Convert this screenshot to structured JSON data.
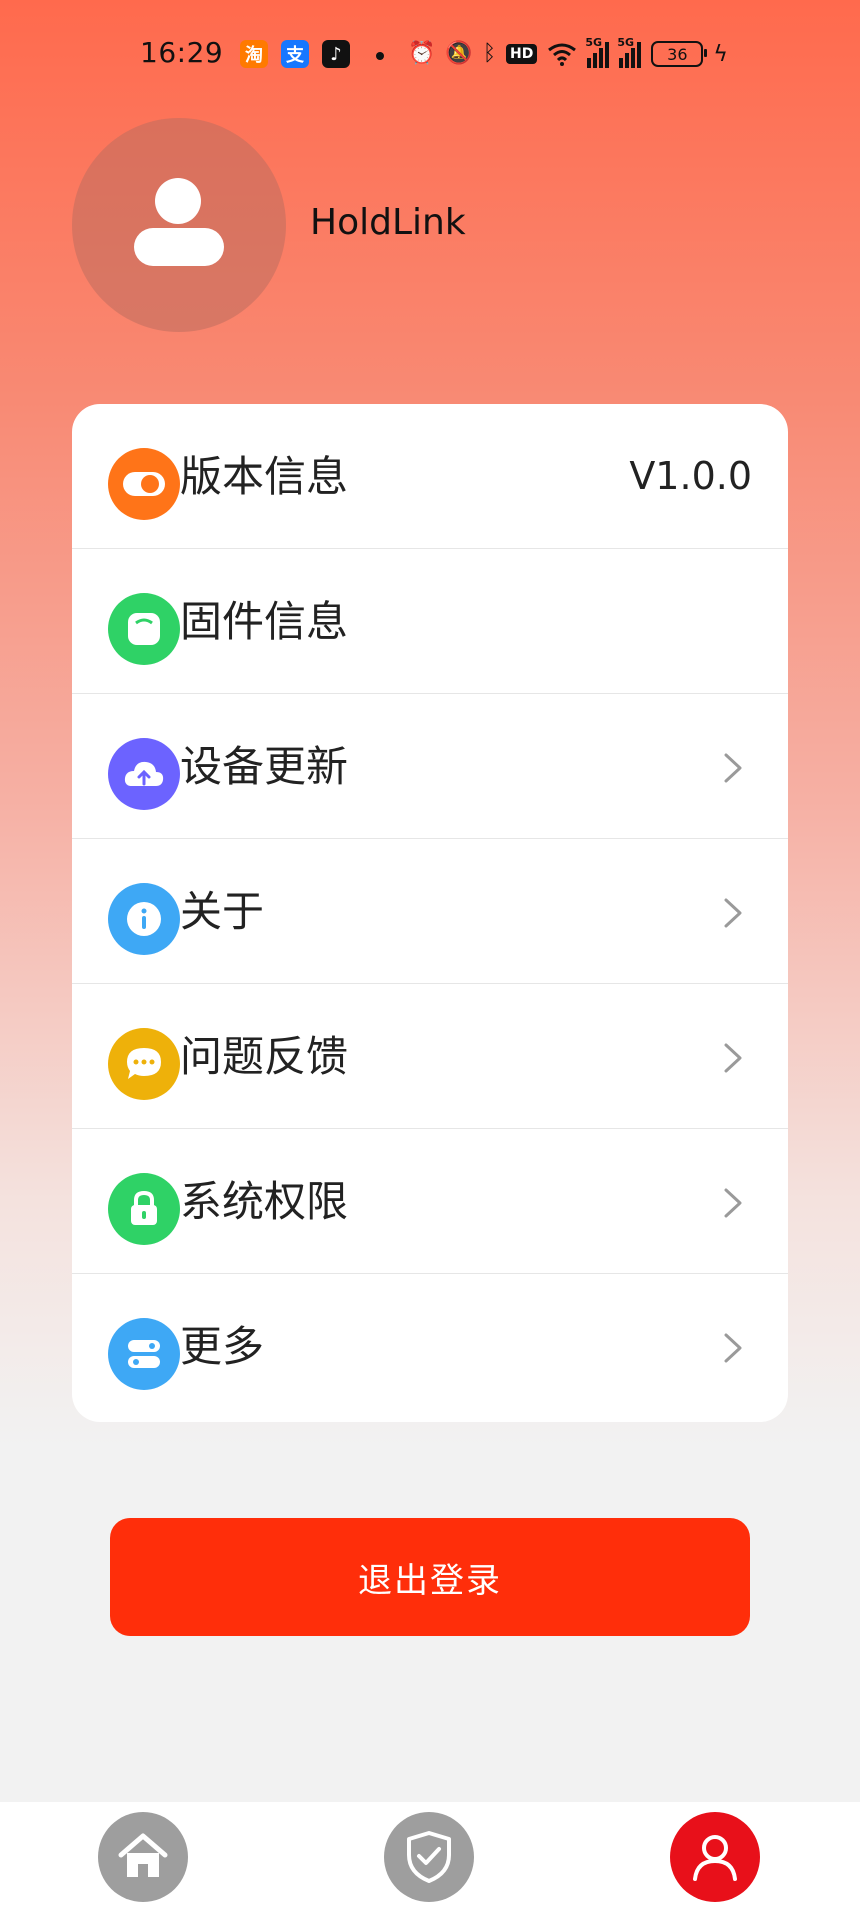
{
  "status_bar": {
    "time": "16:29",
    "app_icons": [
      "taobao-icon",
      "alipay-icon",
      "tiktok-icon"
    ],
    "taobao_glyph": "淘",
    "alipay_glyph": "支",
    "network_label_1": "5G",
    "network_label_2": "5G",
    "hd_label": "HD",
    "battery_level": "36"
  },
  "profile": {
    "username": "HoldLink"
  },
  "menu": {
    "items": [
      {
        "label": "版本信息",
        "value": "V1.0.0",
        "icon": "toggle-icon",
        "color": "#FF7418",
        "has_chevron": false
      },
      {
        "label": "固件信息",
        "value": "",
        "icon": "chip-icon",
        "color": "#2FD266",
        "has_chevron": false
      },
      {
        "label": "设备更新",
        "value": "",
        "icon": "cloud-upload-icon",
        "color": "#6C63FF",
        "has_chevron": true
      },
      {
        "label": "关于",
        "value": "",
        "icon": "info-icon",
        "color": "#3EA8F5",
        "has_chevron": true
      },
      {
        "label": "问题反馈",
        "value": "",
        "icon": "chat-bubble-icon",
        "color": "#EEB10A",
        "has_chevron": true
      },
      {
        "label": "系统权限",
        "value": "",
        "icon": "lock-icon",
        "color": "#2FD266",
        "has_chevron": true
      },
      {
        "label": "更多",
        "value": "",
        "icon": "settings-toggles-icon",
        "color": "#3EA8F5",
        "has_chevron": true
      }
    ]
  },
  "logout_label": "退出登录",
  "bottom_nav": {
    "items": [
      {
        "icon": "home-icon",
        "active": false
      },
      {
        "icon": "shield-check-icon",
        "active": false
      },
      {
        "icon": "profile-icon",
        "active": true
      }
    ],
    "active_color": "#E8101A",
    "inactive_color": "#9E9E9E"
  },
  "colors": {
    "accent": "#FF2E0A",
    "header_gradient_top": "#FF6A4D"
  }
}
